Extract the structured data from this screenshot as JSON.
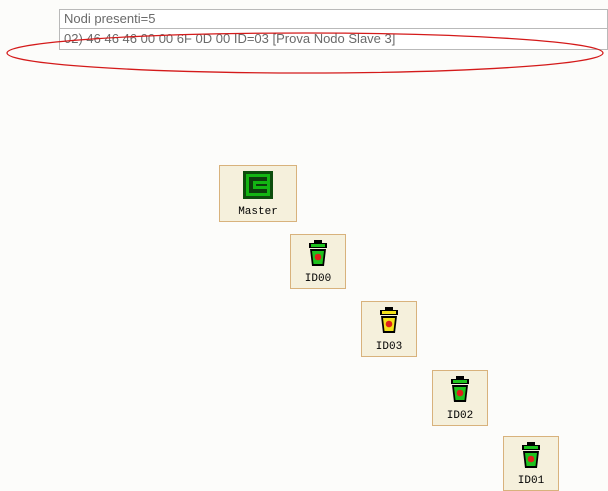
{
  "info": {
    "line1": "Nodi presenti=5",
    "line2": "02) 46 46 46 00 00 6F 0D 00  ID=03 [Prova Nodo Slave 3]"
  },
  "nodes": {
    "master": {
      "label": "Master",
      "icon": "master-chip-icon"
    },
    "id00": {
      "label": "ID00",
      "icon": "green-bin-icon"
    },
    "id03": {
      "label": "ID03",
      "icon": "yellow-bin-icon"
    },
    "id02": {
      "label": "ID02",
      "icon": "green-bin-icon"
    },
    "id01": {
      "label": "ID01",
      "icon": "green-bin-icon"
    }
  },
  "colors": {
    "highlight_ellipse": "#d41a1a",
    "node_bg": "#f5f0dc",
    "node_border": "#d8b27c",
    "slave_ok": "#1ec21e",
    "slave_selected": "#f2e21a",
    "status_dot": "#e0201a"
  }
}
